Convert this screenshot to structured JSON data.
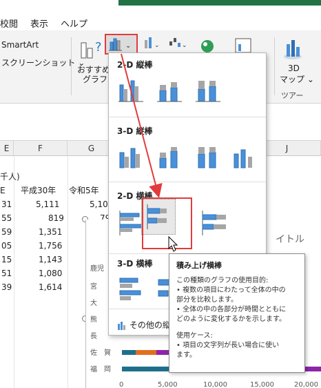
{
  "menu": {
    "items": [
      "校閲",
      "表示",
      "ヘルプ"
    ]
  },
  "ribbon": {
    "smartart_label": "SmartArt",
    "screenshot_label": "スクリーンショット ⌄",
    "recommended_chart_label_line1": "おすすめ",
    "recommended_chart_label_line2": "グラフ",
    "map3d_line1": "3D",
    "map3d_line2": "マップ ⌄",
    "tour_group_label": "ツアー",
    "chevron": "⌄"
  },
  "dropdown": {
    "section_2d_column": "2-D 縦棒",
    "section_3d_column": "3-D 縦棒",
    "section_2d_bar": "2-D 横棒",
    "section_3d_bar": "3-D 横棒",
    "more_charts_label": "その他の縦"
  },
  "tooltip": {
    "title": "積み上げ横棒",
    "lines": [
      "この種類のグラフの使用目的:",
      "• 複数の項目にわたって全体の中の",
      "  部分を比較します。",
      "• 全体の中の各部分が時間とともに",
      "  どのように変化するかを示します。"
    ],
    "usage_heading": "使用ケース:",
    "usage_lines": [
      "• 項目の文字列が長い場合に使い",
      "  ます。"
    ]
  },
  "sheet": {
    "columns": [
      "E",
      "F",
      "G",
      "J"
    ],
    "unit_fragment": "千人)",
    "header_row": [
      "E",
      "平成30年",
      "令和5年"
    ],
    "rows": [
      [
        "31",
        "5,111",
        "5,10"
      ],
      [
        "55",
        "819",
        "79"
      ],
      [
        "59",
        "1,351",
        ""
      ],
      [
        "05",
        "1,756",
        ""
      ],
      [
        "15",
        "1,143",
        ""
      ],
      [
        "51",
        "1,080",
        ""
      ],
      [
        "39",
        "1,614",
        ""
      ]
    ]
  },
  "chart": {
    "title_fragment": "イトル",
    "category_labels": [
      "鹿児",
      "宮",
      "大",
      "熊",
      "長",
      "佐　賀",
      "福　岡"
    ],
    "x_ticks": [
      "0",
      "5,000",
      "10,000",
      "15,000",
      "20,000"
    ],
    "colors": {
      "series1": "#1f6f8b",
      "series2": "#e0701f",
      "series3": "#8e24aa"
    }
  },
  "colors": {
    "accent_red": "#e23b3b",
    "excel_green": "#217346",
    "chart_blue": "#4a90d9",
    "chart_gray": "#a6a6a6"
  }
}
